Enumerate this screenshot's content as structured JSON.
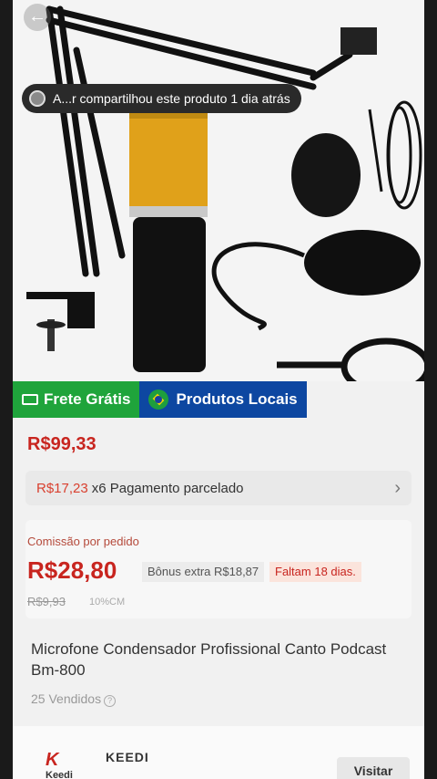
{
  "share": {
    "text": "A...r compartilhou este produto 1 dia atrás"
  },
  "badges": {
    "free_shipping": "Frete Grátis",
    "local_products": "Produtos Locais"
  },
  "product": {
    "price": "R$99,33",
    "title": "Microfone Condensador Profissional Canto Podcast Bm-800",
    "sold": "25 Vendidos"
  },
  "installment": {
    "amount": "R$17,23",
    "text": "x6 Pagamento parcelado"
  },
  "commission": {
    "label": "Comissão por pedido",
    "value": "R$28,80",
    "bonus": "Bônus extra R$18,87",
    "time_left": "Faltam 18 dias.",
    "old_value": "R$9,93",
    "percent": "10%CM"
  },
  "store": {
    "logo_text": "Keedi",
    "name": "KEEDI",
    "visit_label": "Visitar"
  },
  "icons": [
    "back-arrow-icon",
    "truck-icon",
    "brazil-flag-icon",
    "chevron-right-icon",
    "question-icon"
  ],
  "colors": {
    "price_red": "#c8251f",
    "free_green": "#1fa43b",
    "local_blue": "#0d47a1"
  }
}
